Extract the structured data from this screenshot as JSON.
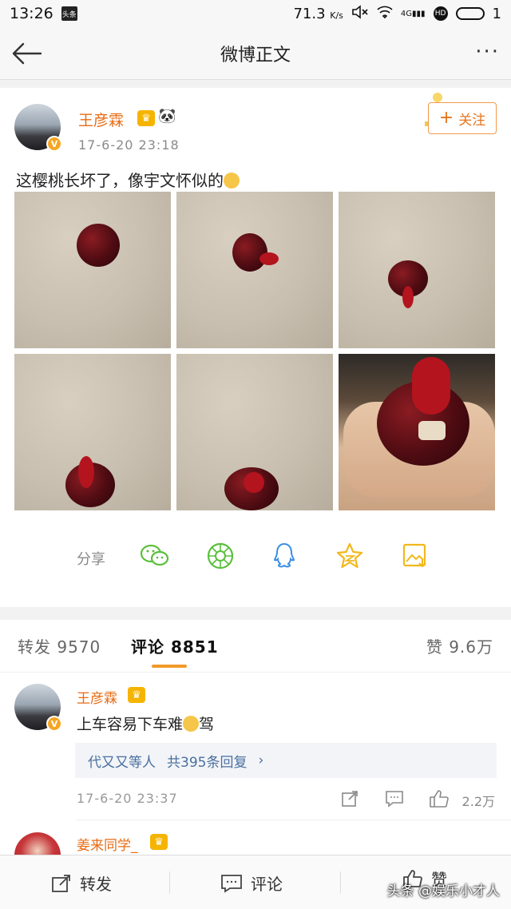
{
  "status_bar": {
    "time": "13:26",
    "app_icon_text": "头条",
    "speed": "71.3",
    "speed_unit": "K/s",
    "network": "4G",
    "battery": "1"
  },
  "nav": {
    "title": "微博正文"
  },
  "post": {
    "author": "王彦霖",
    "time": "17-6-20 23:18",
    "follow_label": "关注",
    "text": "这樱桃长坏了，像宇文怀似的"
  },
  "share": {
    "label": "分享",
    "targets": [
      "wechat-icon",
      "moments-icon",
      "qq-icon",
      "qzone-icon",
      "save-image-icon"
    ]
  },
  "tabs": {
    "repost_label": "转发",
    "repost_count": "9570",
    "comment_label": "评论",
    "comment_count": "8851",
    "like_label": "赞",
    "like_count": "9.6万"
  },
  "comments": [
    {
      "author": "王彦霖",
      "text": "上车容易下车难",
      "text_suffix": "驾",
      "reply_users": "代又又等人",
      "reply_count_text": "共395条回复",
      "time": "17-6-20 23:37",
      "like_count": "2.2万"
    },
    {
      "author": "姜来同学_"
    }
  ],
  "bottom_bar": {
    "repost": "转发",
    "comment": "评论",
    "like": "赞"
  },
  "watermark": "头条 @娱乐小才人",
  "colors": {
    "accent_orange": "#e86c15",
    "follow_border": "#f29a4a",
    "tab_underline": "#f29a2a",
    "reply_link": "#4a6fa0",
    "share_green": "#5ac03b",
    "share_blue": "#3a8ee6",
    "share_yellow": "#f2b81c"
  }
}
